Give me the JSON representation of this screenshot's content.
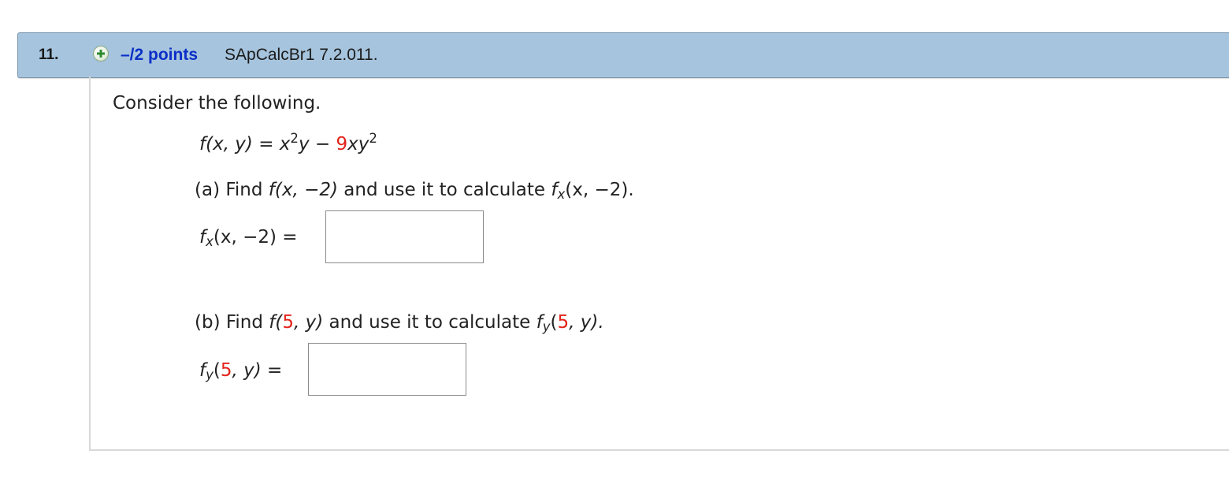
{
  "header": {
    "question_number": "11.",
    "points": "–/2 points",
    "assignment_id": "SApCalcBr1 7.2.011.",
    "colors": {
      "bar": "#a6c4dd",
      "points_text": "#0b2fc7"
    },
    "icon": "plus-circle-icon"
  },
  "question": {
    "intro": "Consider the following.",
    "function_def": {
      "lhs": "f(x, y) = x",
      "exp1": "2",
      "mid": "y − ",
      "coef": "9",
      "var": "xy",
      "exp2": "2"
    },
    "part_a": {
      "prompt_prefix": "(a) Find ",
      "prompt_func": "f(x, −2)",
      "prompt_mid": " and use it to calculate ",
      "prompt_f": "f",
      "prompt_sub": "x",
      "prompt_args": "(x, −2).",
      "answer_label_f": "f",
      "answer_label_sub": "x",
      "answer_label_args": "(x, −2) =",
      "answer_value": ""
    },
    "part_b": {
      "prompt_prefix": "(b) Find ",
      "prompt_f_open": "f(",
      "prompt_num": "5",
      "prompt_f_close": ", y)",
      "prompt_mid": " and use it to calculate ",
      "prompt_f": "f",
      "prompt_sub": "y",
      "prompt_open": "(",
      "prompt_num2": "5",
      "prompt_close": ", y).",
      "answer_label_f": "f",
      "answer_label_sub": "y",
      "answer_label_open": "(",
      "answer_label_num": "5",
      "answer_label_close": ", y) =",
      "answer_value": ""
    },
    "highlight_color": "#e2231a"
  }
}
